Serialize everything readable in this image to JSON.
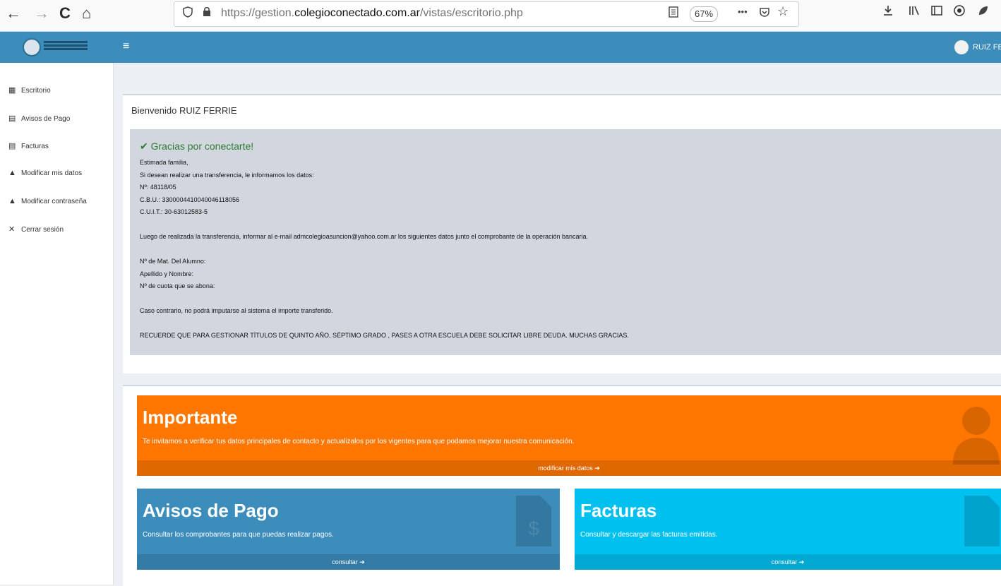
{
  "browser": {
    "back_icon": "←",
    "forward_icon": "→",
    "reload_icon": "C",
    "home_icon": "⌂",
    "url_prefix": "https://gestion.",
    "url_domain": "colegioconectado.com.ar",
    "url_path": "/vistas/escritorio.php",
    "zoom": "67%",
    "more_icon": "•••"
  },
  "header": {
    "menu_icon": "≡",
    "user_name": "RUIZ FE"
  },
  "sidebar": {
    "items": [
      {
        "icon": "▦",
        "label": "Escritorio"
      },
      {
        "icon": "▤",
        "label": "Avisos de Pago"
      },
      {
        "icon": "▤",
        "label": "Facturas"
      },
      {
        "icon": "▲",
        "label": "Modificar mis datos"
      },
      {
        "icon": "▲",
        "label": "Modificar contraseña"
      },
      {
        "icon": "✕",
        "label": "Cerrar sesión"
      }
    ]
  },
  "welcome": "Bienvenido RUIZ FERRIE",
  "alert": {
    "check_icon": "✔",
    "title": "Gracias por conectarte!",
    "lines": [
      "Estimada familia,",
      "Si desean realizar una transferencia, le informamos los datos:",
      "Nº: 48118/05",
      "C.B.U.: 3300004410040046118056",
      "C.U.I.T.: 30-63012583-5",
      "",
      "Luego de realizada la transferencia, informar al e-mail admcolegioasuncion@yahoo.com.ar los siguientes datos junto el comprobante de la operación bancaria.",
      "",
      "Nº de Mat. Del Alumno:",
      "Apellido y Nombre:",
      "Nº de cuota que se abona:",
      "",
      "Caso contrario, no podrá imputarse al sistema el importe transferido.",
      "",
      "RECUERDE QUE PARA GESTIONAR TÍTULOS DE QUINTO AÑO, SÉPTIMO GRADO , PASES A OTRA ESCUELA DEBE SOLICITAR LIBRE DEUDA. MUCHAS GRACIAS."
    ]
  },
  "important": {
    "title": "Importante",
    "text": "Te invitamos a verificar tus datos principales de contacto y actualizalos por los vigentes para que podamos mejorar nuestra comunicación.",
    "link": "modificar mis datos ➔",
    "color": "#ff7701"
  },
  "avisos": {
    "title": "Avisos de Pago",
    "text": "Consultar los comprobantes para que puedas realizar pagos.",
    "link": "consultar ➔",
    "color": "#3c8dbc"
  },
  "facturas": {
    "title": "Facturas",
    "text": "Consultar y descargar las facturas emitidas.",
    "link": "consultar ➔",
    "color": "#00c0ef"
  }
}
